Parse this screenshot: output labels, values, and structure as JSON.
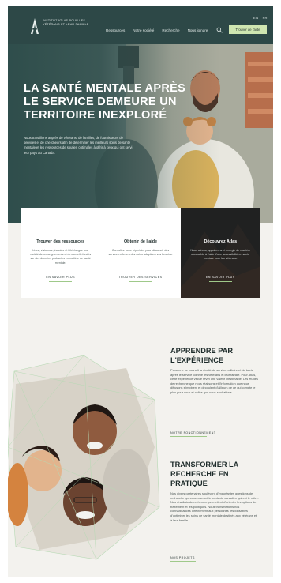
{
  "nav": {
    "logo_text": "Institut Atlas pour les vétérans et leur famille",
    "links": [
      "Ressources",
      "Notre société",
      "Recherche",
      "Nous joindre"
    ],
    "cta": "Trouver de l'aide",
    "lang": "EN · FR",
    "search_icon": "search-icon"
  },
  "hero": {
    "title": "La santé mentale après le service demeure un territoire inexploré",
    "text": "Nous travaillons auprès de vétérans, de familles, de fournisseurs de services et de chercheurs afin de déterminer les meilleurs soins de santé mentale et les ressources de soutien optimales à offrir à ceux qui ont servi leur pays au Canada."
  },
  "cards": [
    {
      "title": "Trouver des ressources",
      "text": "Lisez, visionnez, écoutez et téléchargez une variété de renseignements et de conseils fondés sur des données probantes en matière de santé mentale.",
      "link": "EN SAVOIR PLUS"
    },
    {
      "title": "Obtenir de l'aide",
      "text": "Consultez notre répertoire pour découvrir des services offerts à des coins adaptés à vos besoins.",
      "link": "TROUVER DES SERVICES"
    },
    {
      "title": "Découvrez Atlas",
      "text": "Nous créons, appuierons et énergie de manière accessible à l'aide d'une accessibilité en santé mentale pour les vétérans.",
      "link": "EN SAVOIR PLUS"
    }
  ],
  "section1": {
    "title": "Apprendre par l'expérience",
    "text": "Personne ne connaît la réalité du service militaire et de la vie après le service comme les vétérans et leur famille. Pour Atlas, cette expérience vécue revêt une valeur inestimable. Les études de recherche que nous réalisons et l'information que nous diffusons s'inspirent et découlent d'ailleurs de ce qui compte le plus pour vous et celles que nous souhaitons.",
    "link": "NOTRE FONCTIONNEMENT"
  },
  "section2": {
    "title": "Transformer la recherche en pratique",
    "text": "Nos divers partenaires soulèvent d'importantes questions de recherche qui concerneront le contexte canadien qui est le nôtre. Nos résultats de recherche permettent d'orienter les options de traitement et les politiques. Nous transmettons nos connaissances directement aux personnes responsables d'optimiser les soins de santé mentale destinés aux vétérans et à leur famille.",
    "link": "NOS PROJETS"
  },
  "colors": {
    "nav_bg": "#2d4847",
    "accent": "#cfe6b1",
    "underline": "#9fc98a",
    "page_bg": "#f3f2ee",
    "dark_card": "#2a2d2c"
  }
}
